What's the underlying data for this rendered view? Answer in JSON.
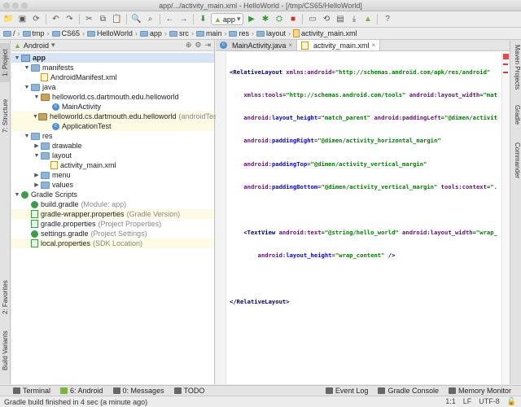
{
  "window": {
    "title": "app/.../activity_main.xml - HelloWorld - [/tmp/CS65/HelloWorld]"
  },
  "toolbar": {
    "run_config": "app"
  },
  "breadcrumbs": [
    "/",
    "tmp",
    "CS65",
    "HelloWorld",
    "app",
    "src",
    "main",
    "res",
    "layout",
    "activity_main.xml"
  ],
  "project_panel": {
    "view_selector": "Android",
    "tree": [
      {
        "label": "app",
        "sub": ""
      },
      {
        "label": "manifests",
        "sub": ""
      },
      {
        "label": "AndroidManifest.xml",
        "sub": ""
      },
      {
        "label": "java",
        "sub": ""
      },
      {
        "label": "helloworld.cs.dartmouth.edu.helloworld",
        "sub": ""
      },
      {
        "label": "MainActivity",
        "sub": ""
      },
      {
        "label": "helloworld.cs.dartmouth.edu.helloworld",
        "sub": "(androidTest)"
      },
      {
        "label": "ApplicationTest",
        "sub": ""
      },
      {
        "label": "res",
        "sub": ""
      },
      {
        "label": "drawable",
        "sub": ""
      },
      {
        "label": "layout",
        "sub": ""
      },
      {
        "label": "activity_main.xml",
        "sub": ""
      },
      {
        "label": "menu",
        "sub": ""
      },
      {
        "label": "values",
        "sub": ""
      },
      {
        "label": "Gradle Scripts",
        "sub": ""
      },
      {
        "label": "build.gradle",
        "sub": "(Module: app)"
      },
      {
        "label": "gradle-wrapper.properties",
        "sub": "(Gradle Version)"
      },
      {
        "label": "gradle.properties",
        "sub": "(Project Properties)"
      },
      {
        "label": "settings.gradle",
        "sub": "(Project Settings)"
      },
      {
        "label": "local.properties",
        "sub": "(SDK Location)"
      }
    ]
  },
  "editor": {
    "tabs": [
      "MainActivity.java",
      "activity_main.xml"
    ],
    "code": [
      [
        "<",
        "RelativeLayout",
        " ",
        "xmlns:android",
        "=",
        "\"http://schemas.android.com/apk/res/android\""
      ],
      [
        "    ",
        "xmlns:tools",
        "=",
        "\"http://schemas.android.com/tools\"",
        " android:layout_width",
        "=\"mat"
      ],
      [
        "    android:",
        "layout_height",
        "=",
        "\"match_parent\"",
        " android:paddingLeft",
        "=\"@dimen/activit"
      ],
      [
        "    android:",
        "paddingRight",
        "=",
        "\"@dimen/activity_horizontal_margin\"",
        "",
        ""
      ],
      [
        "    android:",
        "paddingTop",
        "=",
        "\"@dimen/activity_vertical_margin\"",
        "",
        ""
      ],
      [
        "    android:",
        "paddingBottom",
        "=",
        "\"@dimen/activity_vertical_margin\"",
        " tools:context",
        "=\"."
      ],
      [
        "",
        "",
        "",
        "",
        "",
        ""
      ],
      [
        "    <",
        "TextView",
        " android:text",
        "=\"@string/hello_world\"",
        " android:layout_width",
        "=\"wrap_"
      ],
      [
        "        android:",
        "layout_height",
        "=",
        "\"wrap_content\"",
        " />",
        ""
      ],
      [
        "",
        "",
        "",
        "",
        "",
        ""
      ],
      [
        "</",
        "RelativeLayout",
        ">",
        "",
        "",
        ""
      ]
    ]
  },
  "left_strip": [
    "1: Project",
    "7: Structure",
    "2: Favorites",
    "Build Variants"
  ],
  "right_strip": [
    "Maven Projects",
    "Gradle",
    "Commander"
  ],
  "bottom_tools": [
    "Terminal",
    "6: Android",
    "0: Messages",
    "TODO",
    "Event Log",
    "Gradle Console",
    "Memory Monitor"
  ],
  "status": {
    "message": "Gradle build finished in 4 sec (a minute ago)",
    "position": "1:1",
    "line_sep": "LF",
    "encoding": "UTF-8"
  }
}
